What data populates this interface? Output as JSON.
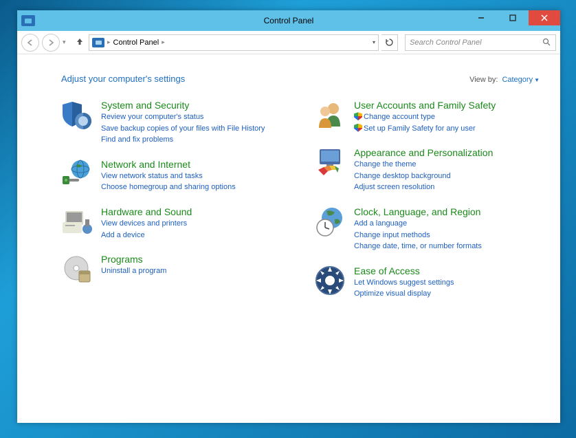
{
  "window": {
    "title": "Control Panel"
  },
  "address": {
    "root": "Control Panel"
  },
  "search": {
    "placeholder": "Search Control Panel"
  },
  "heading": "Adjust your computer's settings",
  "viewby": {
    "label": "View by:",
    "value": "Category"
  },
  "left": [
    {
      "title": "System and Security",
      "links": [
        {
          "text": "Review your computer's status"
        },
        {
          "text": "Save backup copies of your files with File History"
        },
        {
          "text": "Find and fix problems"
        }
      ]
    },
    {
      "title": "Network and Internet",
      "links": [
        {
          "text": "View network status and tasks"
        },
        {
          "text": "Choose homegroup and sharing options"
        }
      ]
    },
    {
      "title": "Hardware and Sound",
      "links": [
        {
          "text": "View devices and printers"
        },
        {
          "text": "Add a device"
        }
      ]
    },
    {
      "title": "Programs",
      "links": [
        {
          "text": "Uninstall a program"
        }
      ]
    }
  ],
  "right": [
    {
      "title": "User Accounts and Family Safety",
      "links": [
        {
          "text": "Change account type",
          "shield": true
        },
        {
          "text": "Set up Family Safety for any user",
          "shield": true
        }
      ]
    },
    {
      "title": "Appearance and Personalization",
      "links": [
        {
          "text": "Change the theme"
        },
        {
          "text": "Change desktop background"
        },
        {
          "text": "Adjust screen resolution"
        }
      ]
    },
    {
      "title": "Clock, Language, and Region",
      "links": [
        {
          "text": "Add a language"
        },
        {
          "text": "Change input methods"
        },
        {
          "text": "Change date, time, or number formats"
        }
      ]
    },
    {
      "title": "Ease of Access",
      "links": [
        {
          "text": "Let Windows suggest settings"
        },
        {
          "text": "Optimize visual display"
        }
      ]
    }
  ]
}
